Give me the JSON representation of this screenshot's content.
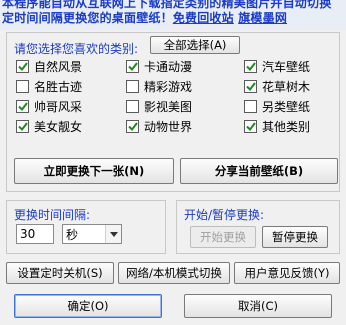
{
  "banner": {
    "line1": "本程序能自动从互联网上下载指定类别的精美图片并自动切换",
    "line2_prefix": "定时间间隔更换您的桌面壁纸！",
    "line2_link1": "免费回收站",
    "line2_link2": "旗模墨网"
  },
  "categories": {
    "title": "请您选择您喜欢的类别:",
    "select_all_label": "全部选择(A)",
    "items": [
      {
        "label": "自然风景",
        "checked": true
      },
      {
        "label": "卡通动漫",
        "checked": true
      },
      {
        "label": "汽车壁纸",
        "checked": true
      },
      {
        "label": "名胜古迹",
        "checked": false
      },
      {
        "label": "精彩游戏",
        "checked": false
      },
      {
        "label": "花草树木",
        "checked": true
      },
      {
        "label": "帅哥风采",
        "checked": true
      },
      {
        "label": "影视美图",
        "checked": false
      },
      {
        "label": "另类壁纸",
        "checked": false
      },
      {
        "label": "美女靓女",
        "checked": true
      },
      {
        "label": "动物世界",
        "checked": true
      },
      {
        "label": "其他类别",
        "checked": true
      }
    ],
    "change_now_label": "立即更换下一张(N)",
    "share_label": "分享当前壁纸(B)"
  },
  "interval": {
    "title": "更换时间间隔:",
    "value": "30",
    "unit": "秒"
  },
  "toggle": {
    "title": "开始/暂停更换:",
    "start_label": "开始更换",
    "pause_label": "暂停更换"
  },
  "bottom": {
    "timer_shutdown_label": "设置定时关机(S)",
    "network_mode_label": "网络/本机模式切换",
    "feedback_label": "用户意见反馈(Y)",
    "ok_label": "确定(O)",
    "cancel_label": "取消(C)"
  },
  "colors": {
    "label_blue": "#1a3cc8",
    "check_green": "#1e8a1e"
  }
}
